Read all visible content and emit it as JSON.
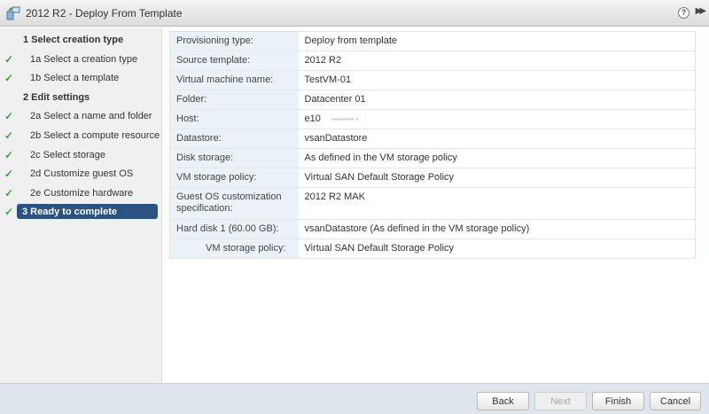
{
  "window": {
    "title": "2012 R2 - Deploy From Template",
    "help": "?",
    "expand": "▶▶"
  },
  "steps": [
    {
      "label": "1  Select creation type",
      "type": "header",
      "done": false
    },
    {
      "label": "1a  Select a creation type",
      "type": "sub",
      "done": true
    },
    {
      "label": "1b  Select a template",
      "type": "sub",
      "done": true
    },
    {
      "label": "2  Edit settings",
      "type": "header",
      "done": false
    },
    {
      "label": "2a  Select a name and folder",
      "type": "sub",
      "done": true
    },
    {
      "label": "2b  Select a compute resource",
      "type": "sub",
      "done": true
    },
    {
      "label": "2c  Select storage",
      "type": "sub",
      "done": true
    },
    {
      "label": "2d  Customize guest OS",
      "type": "sub",
      "done": true
    },
    {
      "label": "2e  Customize hardware",
      "type": "sub",
      "done": true
    },
    {
      "label": "3  Ready to complete",
      "type": "active",
      "done": true
    }
  ],
  "check": "✓",
  "summary": [
    {
      "key": "Provisioning type:",
      "value": "Deploy from template"
    },
    {
      "key": "Source template:",
      "value": "2012 R2"
    },
    {
      "key": "Virtual machine name:",
      "value": "TestVM-01"
    },
    {
      "key": "Folder:",
      "value": "Datacenter 01"
    },
    {
      "key": "Host:",
      "value": "e10"
    },
    {
      "key": "Datastore:",
      "value": "vsanDatastore"
    },
    {
      "key": "Disk storage:",
      "value": "As defined in the VM storage policy"
    },
    {
      "key": "VM storage policy:",
      "value": "Virtual SAN Default Storage Policy"
    },
    {
      "key": "Guest OS customization specification:",
      "value": "2012 R2 MAK"
    },
    {
      "key": "Hard disk 1 (60.00 GB):",
      "value": "vsanDatastore (As defined in the VM storage policy)"
    },
    {
      "key": "VM storage policy:",
      "value": "Virtual SAN Default Storage Policy"
    }
  ],
  "buttons": {
    "back": "Back",
    "next": "Next",
    "finish": "Finish",
    "cancel": "Cancel"
  }
}
